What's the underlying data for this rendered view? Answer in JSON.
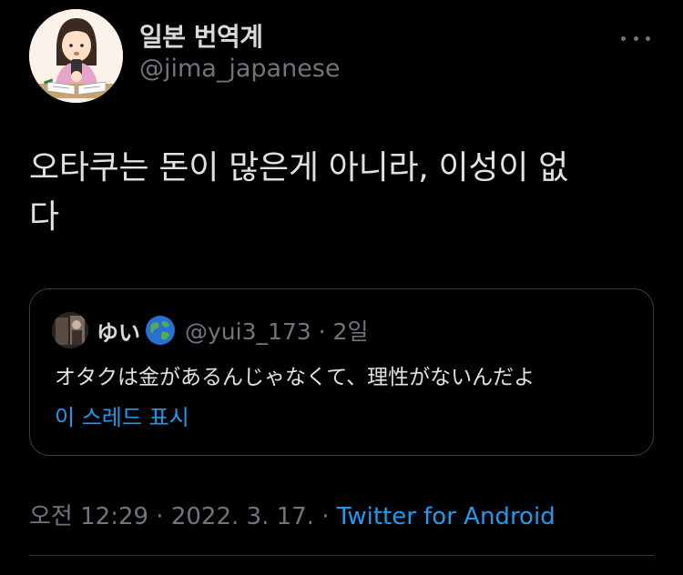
{
  "author": {
    "display_name": "일본 번역계",
    "handle": "@jima_japanese",
    "avatar_icon": "illustrated-person-reading-avatar"
  },
  "more_icon": "more-dots-icon",
  "tweet": {
    "text_line1": "오타쿠는 돈이 많은게 아니라, 이성이 없",
    "text_line2": "다"
  },
  "quote": {
    "display_name": "ゆい",
    "globe_icon": "globe-emoji-icon",
    "handle_time": "@yui3_173 · 2일",
    "text": "オタクは金があるんじゃなくて、理性がないんだよ",
    "thread_link": "이 스레드 표시"
  },
  "meta": {
    "timestamp": "오전 12:29 · 2022. 3. 17. · ",
    "source": "Twitter for Android"
  },
  "colors": {
    "background": "#000000",
    "link": "#1d9bf0",
    "secondary_text": "#6e767d",
    "border": "#3a3d41"
  }
}
